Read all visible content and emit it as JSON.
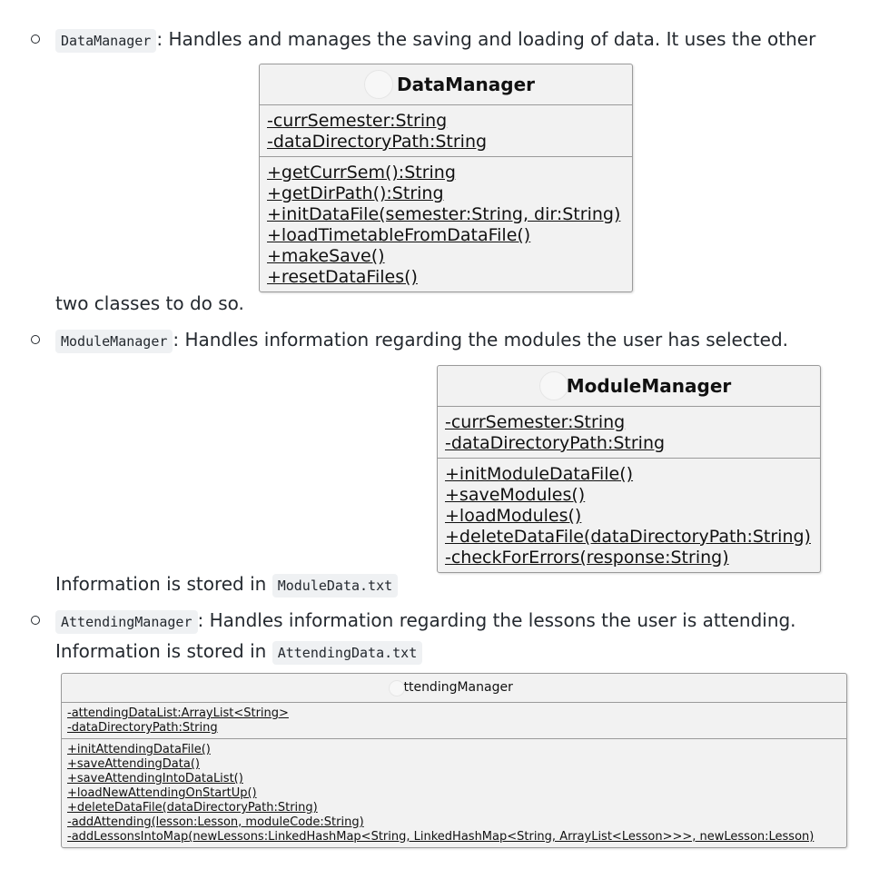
{
  "items": [
    {
      "code": "DataManager",
      "text": ": Handles and manages the saving and loading of data. It uses the other",
      "continuation": "two classes to do so.",
      "diagram": {
        "class_name": "DataManager",
        "attributes": [
          "-currSemester:String",
          "-dataDirectoryPath:String"
        ],
        "methods": [
          "+getCurrSem():String",
          "+getDirPath():String",
          "+initDataFile(semester:String, dir:String)",
          "+loadTimetableFromDataFile()",
          "+makeSave()",
          "+resetDataFiles()"
        ]
      }
    },
    {
      "code": "ModuleManager",
      "text": ": Handles information regarding the modules the user has selected.",
      "storage_prefix": "Information is stored in",
      "storage_file": "ModuleData.txt",
      "diagram": {
        "class_name": "ModuleManager",
        "attributes": [
          "-currSemester:String",
          "-dataDirectoryPath:String"
        ],
        "methods": [
          "+initModuleDataFile()",
          "+saveModules()",
          "+loadModules()",
          "+deleteDataFile(dataDirectoryPath:String)",
          "-checkForErrors(response:String)"
        ]
      }
    },
    {
      "code": "AttendingManager",
      "text": ": Handles information regarding the lessons the user is attending.",
      "storage_prefix": "Information is stored in",
      "storage_file": "AttendingData.txt",
      "diagram": {
        "class_name": "AttendingManager",
        "attributes": [
          "-attendingDataList:ArrayList<String>",
          "-dataDirectoryPath:String"
        ],
        "methods": [
          "+initAttendingDataFile()",
          "+saveAttendingData()",
          "+saveAttendingIntoDataList()",
          "+loadNewAttendingOnStartUp()",
          "+deleteDataFile(dataDirectoryPath:String)",
          "-addAttending(lesson:Lesson, moduleCode:String)",
          "-addLessonsIntoMap(newLessons:LinkedHashMap<String, LinkedHashMap<String, ArrayList<Lesson>>>, newLesson:Lesson)"
        ]
      }
    }
  ]
}
